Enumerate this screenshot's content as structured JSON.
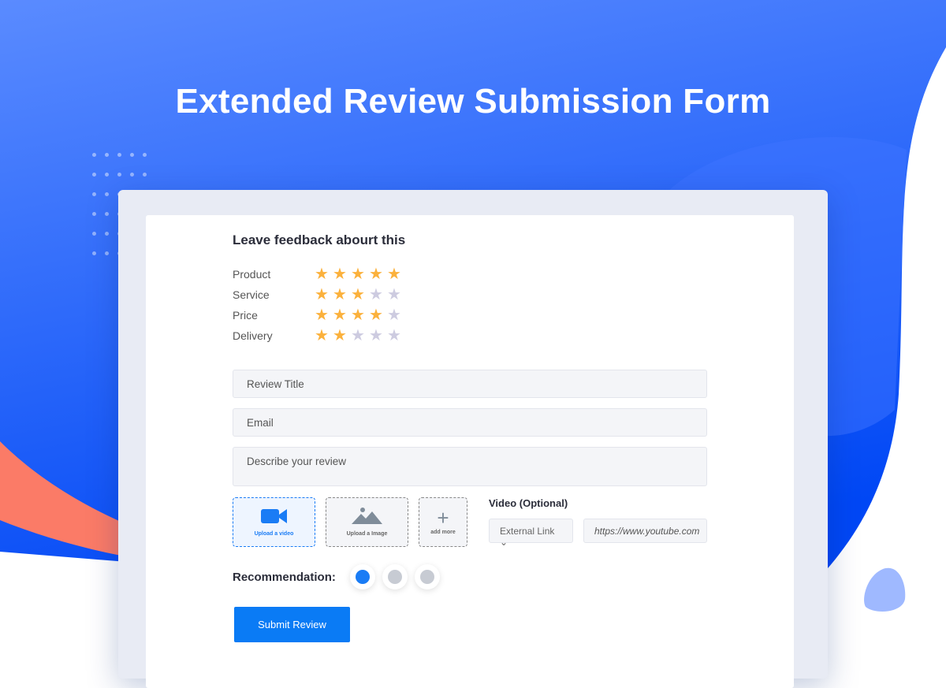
{
  "page": {
    "title": "Extended Review Submission Form"
  },
  "form": {
    "heading": "Leave feedback abourt this",
    "ratings": [
      {
        "label": "Product",
        "stars": 5
      },
      {
        "label": "Service",
        "stars": 3
      },
      {
        "label": "Price",
        "stars": 4
      },
      {
        "label": "Delivery",
        "stars": 2
      }
    ],
    "max_stars": 5,
    "review_title_placeholder": "Review Title",
    "email_placeholder": "Email",
    "description_placeholder": "Describe your review",
    "uploads": {
      "video": "Upload a video",
      "image": "Upload a Image",
      "more": "add more"
    },
    "video_label": "Video (Optional)",
    "video_source": "External Link",
    "video_url_placeholder": "https://www.youtube.com",
    "recommendation_label": "Recommendation:",
    "recommendation_selected": "happy",
    "submit_label": "Submit Review"
  },
  "colors": {
    "accent": "#0a7bf5",
    "star": "#fbb13c",
    "star_off": "#cdcbe0"
  }
}
